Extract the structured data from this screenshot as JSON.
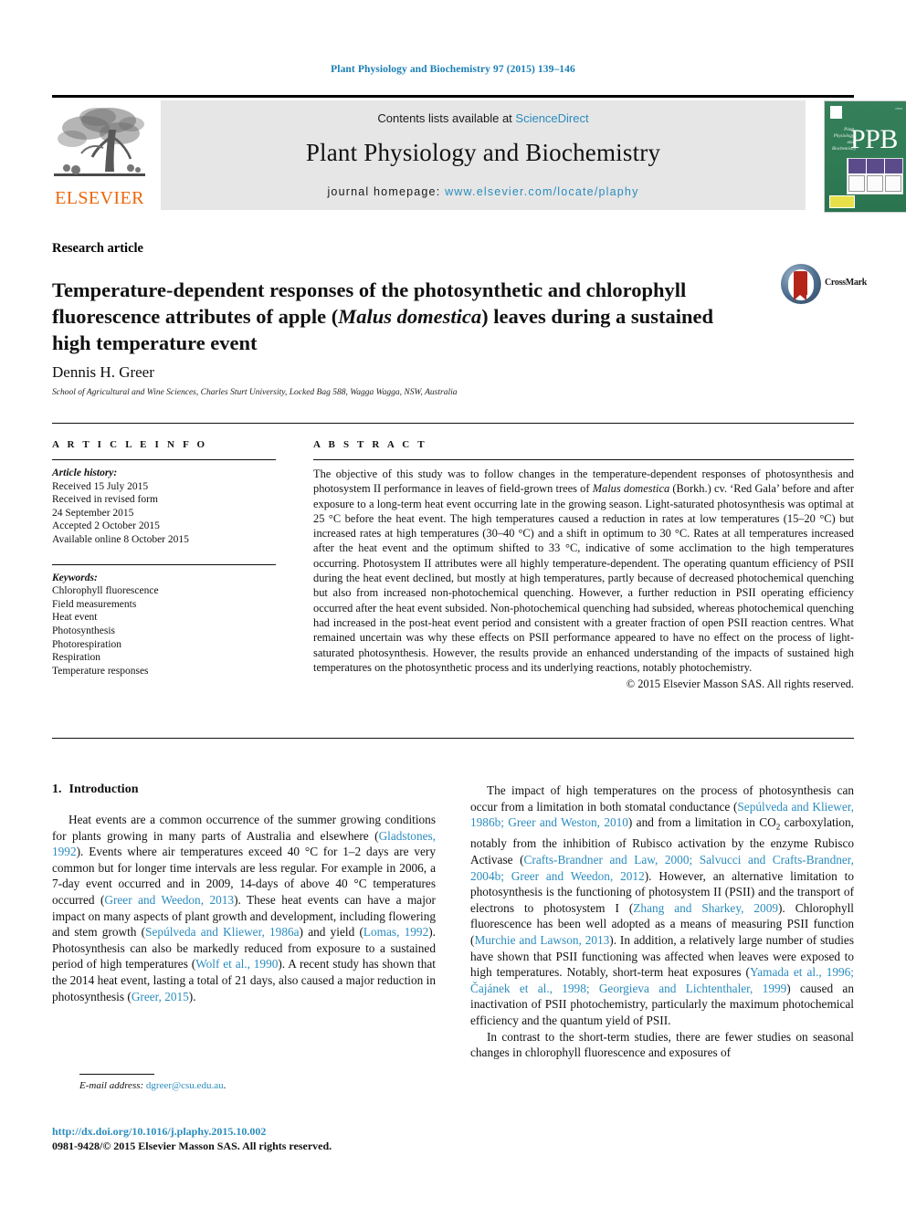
{
  "running_head": "Plant Physiology and Biochemistry 97 (2015) 139–146",
  "masthead": {
    "publisher_name": "ELSEVIER",
    "contents_prefix": "Contents lists available at ",
    "contents_link": "ScienceDirect",
    "journal_title": "Plant Physiology and Biochemistry",
    "homepage_prefix": "journal homepage: ",
    "homepage_url": "www.elsevier.com/locate/plaphy",
    "cover": {
      "acronym": "PPB",
      "side_text": "Plant Physiology and Biochemistry"
    }
  },
  "article": {
    "type": "Research article",
    "title_part1": "Temperature-dependent responses of the photosynthetic and chlorophyll fluorescence attributes of apple (",
    "title_italic": "Malus domestica",
    "title_part2": ") leaves during a sustained high temperature event",
    "author": "Dennis H. Greer",
    "affiliation": "School of Agricultural and Wine Sciences, Charles Sturt University, Locked Bag 588, Wagga Wagga, NSW, Australia",
    "crossmark_label": "CrossMark"
  },
  "article_info": {
    "heading": "A R T I C L E  I N F O",
    "history_label": "Article history:",
    "history": [
      "Received 15 July 2015",
      "Received in revised form",
      "24 September 2015",
      "Accepted 2 October 2015",
      "Available online 8 October 2015"
    ],
    "keywords_label": "Keywords:",
    "keywords": [
      "Chlorophyll fluorescence",
      "Field measurements",
      "Heat event",
      "Photosynthesis",
      "Photorespiration",
      "Respiration",
      "Temperature responses"
    ]
  },
  "abstract": {
    "heading": "A B S T R A C T",
    "text_p1": "The objective of this study was to follow changes in the temperature-dependent responses of photosynthesis and photosystem II performance in leaves of field-grown trees of ",
    "text_italic": "Malus domestica",
    "text_p2": " (Borkh.) cv. ‘Red Gala’ before and after exposure to a long-term heat event occurring late in the growing season. Light-saturated photosynthesis was optimal at 25 °C before the heat event. The high temperatures caused a reduction in rates at low temperatures (15–20 °C) but increased rates at high temperatures (30–40 °C) and a shift in optimum to 30 °C. Rates at all temperatures increased after the heat event and the optimum shifted to 33 °C, indicative of some acclimation to the high temperatures occurring. Photosystem II attributes were all highly temperature-dependent. The operating quantum efficiency of PSII during the heat event declined, but mostly at high temperatures, partly because of decreased photochemical quenching but also from increased non-photochemical quenching. However, a further reduction in PSII operating efficiency occurred after the heat event subsided. Non-photochemical quenching had subsided, whereas photochemical quenching had increased in the post-heat event period and consistent with a greater fraction of open PSII reaction centres. What remained uncertain was why these effects on PSII performance appeared to have no effect on the process of light-saturated photosynthesis. However, the results provide an enhanced understanding of the impacts of sustained high temperatures on the photosynthetic process and its underlying reactions, notably photochemistry.",
    "copyright": "© 2015 Elsevier Masson SAS. All rights reserved."
  },
  "introduction": {
    "number": "1.",
    "heading": "Introduction",
    "left_para1_a": "Heat events are a common occurrence of the summer growing conditions for plants growing in many parts of Australia and elsewhere (",
    "left_ref1": "Gladstones, 1992",
    "left_para1_b": "). Events where air temperatures exceed 40 °C for 1–2 days are very common but for longer time intervals are less regular. For example in 2006, a 7-day event occurred and in 2009, 14-days of above 40 °C temperatures occurred (",
    "left_ref2": "Greer and Weedon, 2013",
    "left_para1_c": "). These heat events can have a major impact on many aspects of plant growth and development, including flowering and stem growth (",
    "left_ref3": "Sepúlveda and Kliewer, 1986a",
    "left_para1_d": ") and yield (",
    "left_ref4": "Lomas, 1992",
    "left_para1_e": "). Photosynthesis can also be markedly reduced from exposure to a sustained period of high temperatures (",
    "left_ref5": "Wolf et al., 1990",
    "left_para1_f": "). A recent study has shown that the 2014 heat event, lasting a total of 21 days, also caused a major reduction in photosynthesis (",
    "left_ref6": "Greer, 2015",
    "left_para1_g": ").",
    "right_para1_a": "The impact of high temperatures on the process of photosynthesis can occur from a limitation in both stomatal conductance (",
    "right_ref1": "Sepúlveda and Kliewer, 1986b; Greer and Weston, 2010",
    "right_para1_b": ") and from a limitation in CO",
    "right_sub1": "2",
    "right_para1_c": " carboxylation, notably from the inhibition of Rubisco activation by the enzyme Rubisco Activase (",
    "right_ref2": "Crafts-Brandner and Law, 2000; Salvucci and Crafts-Brandner, 2004b; Greer and Weedon, 2012",
    "right_para1_d": "). However, an alternative limitation to photosynthesis is the functioning of photosystem II (PSII) and the transport of electrons to photosystem I (",
    "right_ref3": "Zhang and Sharkey, 2009",
    "right_para1_e": "). Chlorophyll fluorescence has been well adopted as a means of measuring PSII function (",
    "right_ref4": "Murchie and Lawson, 2013",
    "right_para1_f": "). In addition, a relatively large number of studies have shown that PSII functioning was affected when leaves were exposed to high temperatures. Notably, short-term heat exposures (",
    "right_ref5": "Yamada et al., 1996; Čajánek et al., 1998; Georgieva and Lichtenthaler, 1999",
    "right_para1_g": ") caused an inactivation of PSII photochemistry, particularly the maximum photochemical efficiency and the quantum yield of PSII.",
    "right_para2": "In contrast to the short-term studies, there are fewer studies on seasonal changes in chlorophyll fluorescence and exposures of"
  },
  "footer": {
    "email_label": "E-mail address:",
    "email": "dgreer@csu.edu.au",
    "email_suffix": ".",
    "doi": "http://dx.doi.org/10.1016/j.plaphy.2015.10.002",
    "issn": "0981-9428/© 2015 Elsevier Masson SAS. All rights reserved."
  },
  "colors": {
    "link_blue": "#2b8cbe",
    "elsevier_orange": "#ec6608",
    "cover_green": "#2b7a52",
    "crossmark_red": "#b42419"
  }
}
